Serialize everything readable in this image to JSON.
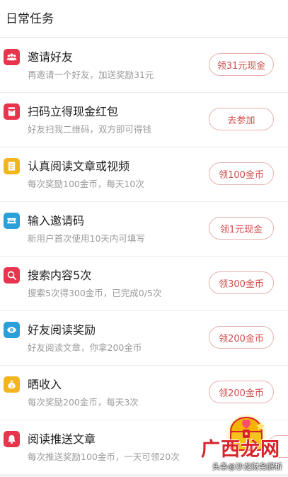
{
  "header": {
    "title": "日常任务"
  },
  "tasks": [
    {
      "title": "邀请好友",
      "desc": "再邀请一个好友，加送奖励31元",
      "button": "领31元现金",
      "icon": "people-icon",
      "color": "#e8344c"
    },
    {
      "title": "扫码立得现金红包",
      "desc": "好友扫我二维码，双方即可得钱",
      "button": "去参加",
      "icon": "red-envelope-icon",
      "color": "#e8344c"
    },
    {
      "title": "认真阅读文章或视频",
      "desc": "每次奖励100金币，每天10次",
      "button": "领100金币",
      "icon": "document-icon",
      "color": "#f2b51c"
    },
    {
      "title": "输入邀请码",
      "desc": "新用户首次使用10天内可填写",
      "button": "领1元现金",
      "icon": "ticket-icon",
      "color": "#2b9fd8"
    },
    {
      "title": "搜索内容5次",
      "desc": "搜索5次得300金币，已完成0/5次",
      "button": "领300金币",
      "icon": "search-icon",
      "color": "#e8344c"
    },
    {
      "title": "好友阅读奖励",
      "desc": "好友阅读文章，你拿200金币",
      "button": "领200金币",
      "icon": "eye-icon",
      "color": "#2b9fd8"
    },
    {
      "title": "晒收入",
      "desc": "每次奖励200金币，每天3次",
      "button": "领200金币",
      "icon": "money-bag-icon",
      "color": "#f2b51c"
    },
    {
      "title": "阅读推送文章",
      "desc": "每次推送奖励100金币，一天可领20次",
      "button": "",
      "icon": "bell-icon",
      "color": "#e8344c"
    }
  ],
  "watermark": {
    "text": "广西龙网",
    "sub": "头条@沙龙财务解析"
  }
}
